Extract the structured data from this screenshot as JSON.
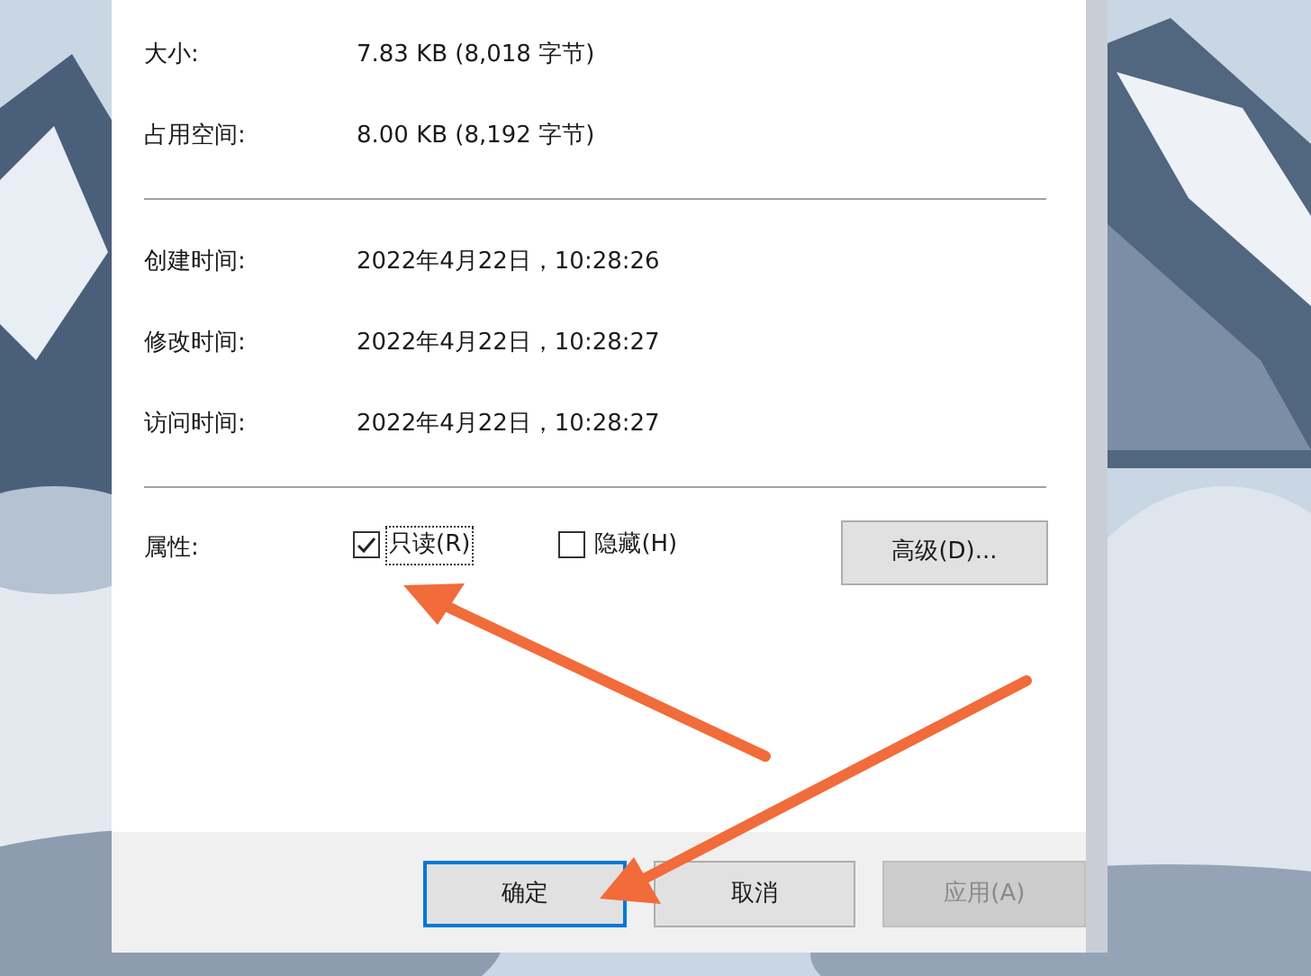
{
  "info_rows": [
    {
      "label": "大小:",
      "value": "7.83 KB (8,018 字节)"
    },
    {
      "label": "占用空间:",
      "value": "8.00 KB (8,192 字节)"
    }
  ],
  "time_rows": [
    {
      "label": "创建时间:",
      "value": "2022年4月22日，10:28:26"
    },
    {
      "label": "修改时间:",
      "value": "2022年4月22日，10:28:27"
    },
    {
      "label": "访问时间:",
      "value": "2022年4月22日，10:28:27"
    }
  ],
  "attributes": {
    "label": "属性:",
    "checkboxes": [
      {
        "label": "只读(R)",
        "checked": true,
        "focused": true
      },
      {
        "label": "隐藏(H)",
        "checked": false,
        "focused": false
      }
    ],
    "advanced_button": "高级(D)..."
  },
  "buttons": [
    {
      "label": "确定",
      "default": true,
      "disabled": false
    },
    {
      "label": "取消",
      "default": false,
      "disabled": false
    },
    {
      "label": "应用(A)",
      "default": false,
      "disabled": true
    }
  ]
}
